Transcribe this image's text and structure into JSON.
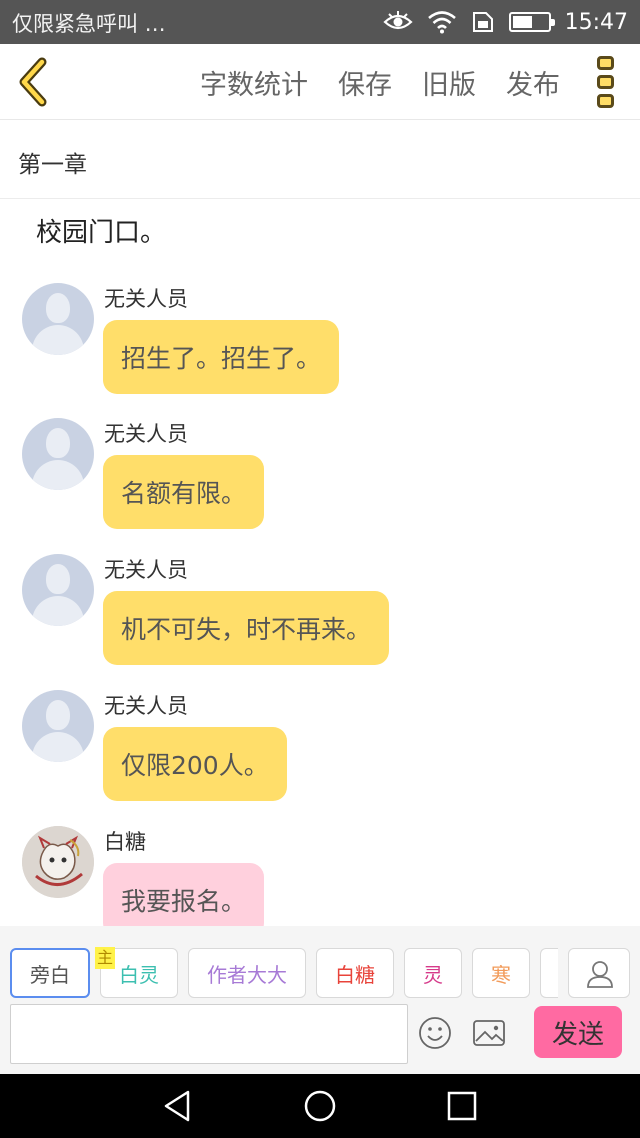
{
  "status_bar": {
    "left_text": "仅限紧急呼叫 …",
    "time": "15:47",
    "battery_level": 0.55
  },
  "toolbar": {
    "back_icon": "back-chevron-icon",
    "actions": [
      "字数统计",
      "保存",
      "旧版",
      "发布"
    ],
    "more_icon": "more-vertical-icon"
  },
  "chapter": {
    "title": "第一章"
  },
  "content": {
    "scene_text": "校园门口。",
    "messages": [
      {
        "sender": "无关人员",
        "text": "招生了。招生了。",
        "bubble_color": "#ffde6a"
      },
      {
        "sender": "无关人员",
        "text": "名额有限。",
        "bubble_color": "#ffde6a"
      },
      {
        "sender": "无关人员",
        "text": "机不可失，时不再来。",
        "bubble_color": "#ffde6a"
      },
      {
        "sender": "无关人员",
        "text": "仅限200人。",
        "bubble_color": "#ffde6a"
      },
      {
        "sender": "白糖",
        "text": "我要报名。",
        "bubble_color": "#ffd0dd"
      }
    ]
  },
  "roles": {
    "items": [
      {
        "label": "旁白",
        "color": "#555555",
        "active": true
      },
      {
        "label": "白灵",
        "color": "#3cbfb0",
        "badge": "主"
      },
      {
        "label": "作者大大",
        "color": "#a77ad6"
      },
      {
        "label": "白糖",
        "color": "#e8433a"
      },
      {
        "label": "灵",
        "color": "#d63a8a"
      },
      {
        "label": "寒",
        "color": "#f29b5a"
      }
    ],
    "user_icon": "user-icon"
  },
  "composer": {
    "input_value": "",
    "send_label": "发送",
    "emoji_icon": "emoji-icon",
    "image_icon": "image-icon"
  },
  "nav": {
    "icons": [
      "back-triangle-icon",
      "home-circle-icon",
      "recent-square-icon"
    ]
  },
  "colors": {
    "accent": "#ffde6a",
    "send": "#ff6aa2",
    "pink_bubble": "#ffd0dd"
  }
}
